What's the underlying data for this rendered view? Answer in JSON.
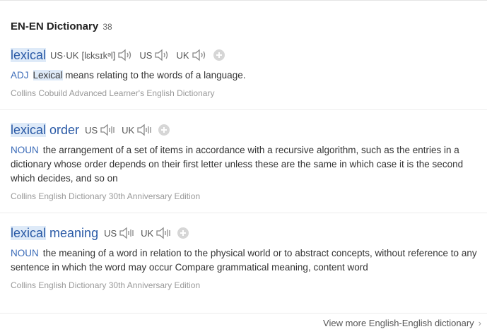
{
  "section": {
    "title": "EN-EN Dictionary",
    "count": "38"
  },
  "entries": [
    {
      "headword_hl": "lexical",
      "headword_rest": "",
      "phon_label": "US·UK",
      "phonetic": "[lɛksɪkᵊl]",
      "us_label": "US",
      "uk_label": "UK",
      "pos": "ADJ",
      "def_hl": "Lexical",
      "def_rest": " means relating to the words of a language.",
      "source": "Collins Cobuild Advanced Learner's English Dictionary"
    },
    {
      "headword_hl": "lexical",
      "headword_rest": " order",
      "us_label": "US",
      "uk_label": "UK",
      "pos": "NOUN",
      "definition": "the arrangement of a set of items in accordance with a recursive algorithm, such as the entries in a dictionary whose order depends on their first letter unless these are the same in which case it is the second which decides, and so on",
      "source": "Collins English Dictionary 30th Anniversary Edition"
    },
    {
      "headword_hl": "lexical",
      "headword_rest": " meaning",
      "us_label": "US",
      "uk_label": "UK",
      "pos": "NOUN",
      "definition": "the meaning of a word in relation to the physical world or to abstract concepts, without reference to any sentence in which the word may occur Compare grammatical meaning, content word",
      "source": "Collins English Dictionary 30th Anniversary Edition"
    }
  ],
  "footer": {
    "more_link": "View more English-English dictionary"
  }
}
